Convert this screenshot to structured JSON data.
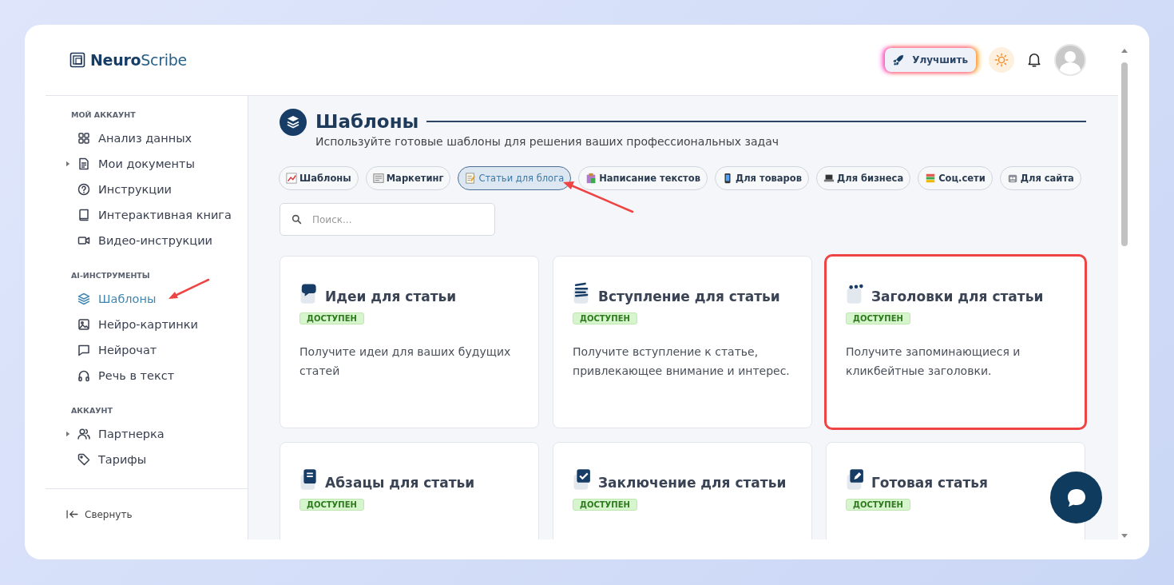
{
  "brand": {
    "name": "**Neuro**Scribe"
  },
  "header": {
    "upgrade_button": "Улучшить"
  },
  "sidebar": {
    "sections": [
      {
        "title": "МОЙ АККАУНТ",
        "items": [
          {
            "label": "Анализ данных",
            "expandable": false,
            "selected": false,
            "pointed": false
          },
          {
            "label": "Мои документы",
            "expandable": true,
            "selected": false,
            "pointed": false
          },
          {
            "label": "Инструкции",
            "expandable": false,
            "selected": false,
            "pointed": false
          },
          {
            "label": "Интерактивная книга",
            "expandable": false,
            "selected": false,
            "pointed": false
          },
          {
            "label": "Видео-инструкции",
            "expandable": false,
            "selected": false,
            "pointed": false
          }
        ]
      },
      {
        "title": "AI-ИНСТРУМЕНТЫ",
        "items": [
          {
            "label": "Шаблоны",
            "expandable": false,
            "selected": true,
            "pointed": true
          },
          {
            "label": "Нейро-картинки",
            "expandable": false,
            "selected": false,
            "pointed": false
          },
          {
            "label": "Нейрочат",
            "expandable": false,
            "selected": false,
            "pointed": false
          },
          {
            "label": "Речь в текст",
            "expandable": false,
            "selected": false,
            "pointed": false
          }
        ]
      },
      {
        "title": "АККАУНТ",
        "items": [
          {
            "label": "Партнерка",
            "expandable": true,
            "selected": false,
            "pointed": false
          },
          {
            "label": "Тарифы",
            "expandable": false,
            "selected": false,
            "pointed": false
          }
        ]
      }
    ],
    "collapse": "Свернуть"
  },
  "main": {
    "title": "Шаблоны",
    "subtitle": "Используйте готовые шаблоны для решения ваших профессиональных задач",
    "chips": [
      {
        "label": "Шаблоны",
        "selected": false,
        "pointed": false
      },
      {
        "label": "Маркетинг",
        "selected": false,
        "pointed": false
      },
      {
        "label": "Статьи для блога",
        "selected": true,
        "pointed": true
      },
      {
        "label": "Написание текстов",
        "selected": false,
        "pointed": false
      },
      {
        "label": "Для товаров",
        "selected": false,
        "pointed": false
      },
      {
        "label": "Для бизнеса",
        "selected": false,
        "pointed": false
      },
      {
        "label": "Соц.сети",
        "selected": false,
        "pointed": false
      },
      {
        "label": "Для сайта",
        "selected": false,
        "pointed": false
      }
    ],
    "search": {
      "placeholder": "Поиск..."
    },
    "cards": [
      {
        "title": "Идеи для статьи",
        "badge": "ДОСТУПЕН",
        "description": "Получите идеи для ваших будущих статей",
        "highlighted": false
      },
      {
        "title": "Вступление для статьи",
        "badge": "ДОСТУПЕН",
        "description": "Получите вступление к статье, привлекающее внимание и интерес.",
        "highlighted": false
      },
      {
        "title": "Заголовки для статьи",
        "badge": "ДОСТУПЕН",
        "description": "Получите запоминающиеся и кликбейтные заголовки.",
        "highlighted": true
      },
      {
        "title": "Абзацы для статьи",
        "badge": "ДОСТУПЕН",
        "highlighted": false
      },
      {
        "title": "Заключение для статьи",
        "badge": "ДОСТУПЕН",
        "highlighted": false
      },
      {
        "title": "Готовая статья",
        "badge": "ДОСТУПЕН",
        "highlighted": false
      }
    ]
  }
}
